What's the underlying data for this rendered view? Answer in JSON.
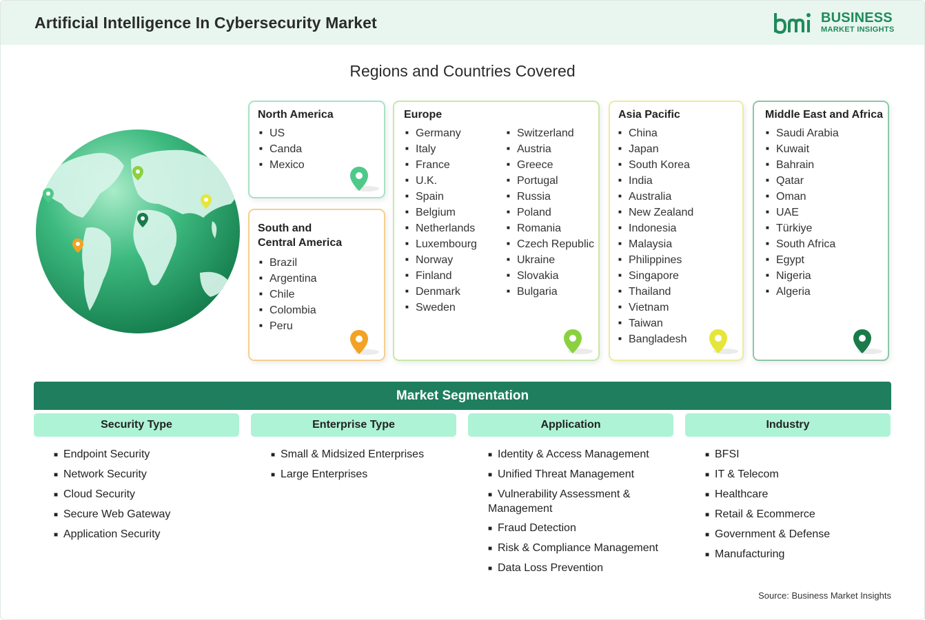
{
  "header": {
    "title": "Artificial Intelligence In Cybersecurity Market"
  },
  "logo": {
    "line1": "BUSINESS",
    "line2": "MARKET INSIGHTS",
    "mark_text": "bmi"
  },
  "regions_title": "Regions and Countries Covered",
  "regions": {
    "north_america": {
      "title": "North America",
      "color": "#4fc98a",
      "countries": [
        "US",
        "Canda",
        "Mexico"
      ]
    },
    "south_america": {
      "title_line1": "South and",
      "title_line2": "Central America",
      "color": "#f2a324",
      "countries": [
        "Brazil",
        "Argentina",
        "Chile",
        "Colombia",
        "Peru"
      ]
    },
    "europe": {
      "title": "Europe",
      "color": "#8bd13f",
      "countries_col1": [
        "Germany",
        "Italy",
        "France",
        "U.K.",
        "Spain",
        "Belgium",
        "Netherlands",
        "Luxembourg",
        "Norway",
        "Finland",
        "Denmark",
        "Sweden"
      ],
      "countries_col2": [
        "Switzerland",
        "Austria",
        "Greece",
        "Portugal",
        "Russia",
        "Poland",
        "Romania",
        "Czech Republic",
        "Ukraine",
        "Slovakia",
        "Bulgaria"
      ]
    },
    "asia_pacific": {
      "title": "Asia Pacific",
      "color": "#e5e63a",
      "countries": [
        "China",
        "Japan",
        "South Korea",
        "India",
        "Australia",
        "New Zealand",
        "Indonesia",
        "Malaysia",
        "Philippines",
        "Singapore",
        "Thailand",
        "Vietnam",
        "Taiwan",
        "Bangladesh"
      ]
    },
    "mea": {
      "title": "Middle East and Africa",
      "color": "#1b7a49",
      "countries": [
        "Saudi Arabia",
        "Kuwait",
        "Bahrain",
        "Qatar",
        "Oman",
        "UAE",
        "Türkiye",
        "South Africa",
        "Egypt",
        "Nigeria",
        "Algeria"
      ]
    }
  },
  "segmentation": {
    "title": "Market Segmentation",
    "columns": [
      {
        "heading": "Security Type",
        "items": [
          "Endpoint Security",
          "Network Security",
          "Cloud Security",
          "Secure Web Gateway",
          "Application Security"
        ]
      },
      {
        "heading": "Enterprise Type",
        "items": [
          "Small & Midsized Enterprises",
          "Large Enterprises"
        ]
      },
      {
        "heading": "Application",
        "items": [
          "Identity & Access Management",
          "Unified Threat Management",
          "Vulnerability Assessment & Management",
          "Fraud Detection",
          "Risk & Compliance Management",
          "Data Loss Prevention"
        ]
      },
      {
        "heading": "Industry",
        "items": [
          "BFSI",
          "IT & Telecom",
          "Healthcare",
          "Retail & Ecommerce",
          "Government & Defense",
          "Manufacturing"
        ]
      }
    ]
  },
  "source": "Source: Business Market Insights",
  "colors": {
    "header_bg": "#e8f6ef",
    "accent": "#1e7e5e",
    "segment_head": "#aef3d6"
  }
}
